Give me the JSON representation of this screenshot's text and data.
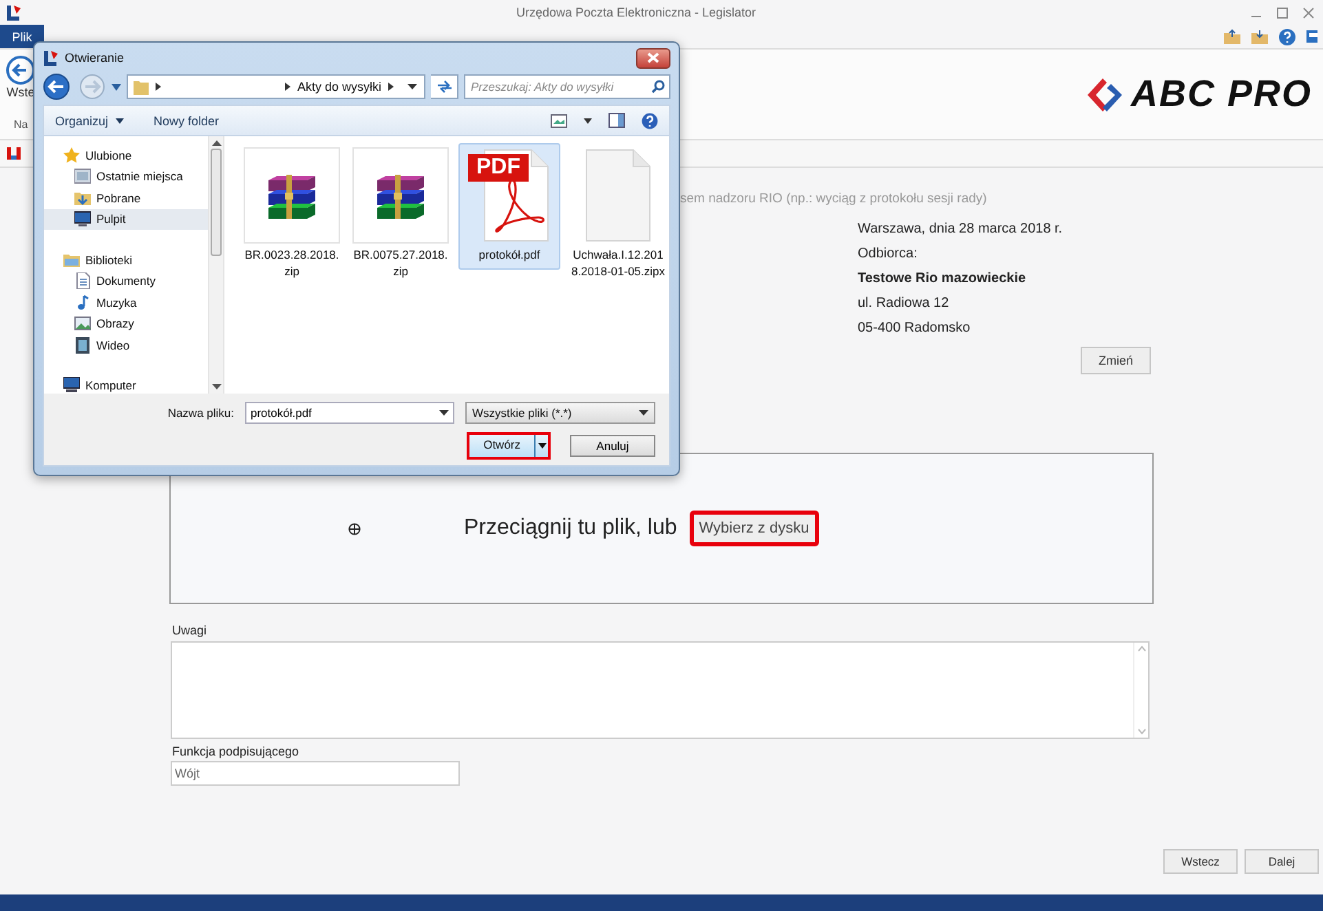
{
  "app": {
    "title": "Urzędowa Poczta Elektroniczna - Legislator",
    "file_tab": "Plik",
    "back_label": "Wste",
    "group_label": "Na",
    "logo": "ABC PRO"
  },
  "form": {
    "hint": "sem nadzoru RIO (np.: wyciąg z protokołu sesji rady)",
    "place_date": "Warszawa, dnia 28 marca 2018 r.",
    "recipient_label": "Odbiorca:",
    "recipient_name": "Testowe Rio mazowieckie",
    "recipient_lines": [
      "ul. Radiowa 12",
      "05-400 Radomsko"
    ],
    "change_button": "Zmień",
    "drop_text": "Przeciągnij tu plik, lub",
    "choose_button": {
      "label": "Wybierz z dysku",
      "highlighted": true
    },
    "notes_label": "Uwagi",
    "signer_label": "Funkcja podpisującego",
    "signer_value": "Wójt"
  },
  "nav_buttons": [
    "Wstecz",
    "Dalej"
  ],
  "dialog": {
    "title": "Otwieranie",
    "path": [
      "Akty do wysyłki"
    ],
    "search_placeholder": "Przeszukaj: Akty do wysyłki",
    "organize": "Organizuj",
    "new_folder": "Nowy folder",
    "nav": [
      {
        "label": "Ulubione",
        "kind": "star",
        "selected": false,
        "children": [
          {
            "label": "Ostatnie miejsca",
            "kind": "recent",
            "selected": false
          },
          {
            "label": "Pobrane",
            "kind": "download",
            "selected": false
          },
          {
            "label": "Pulpit",
            "kind": "desktop",
            "selected": true
          }
        ]
      },
      {
        "label": "Biblioteki",
        "kind": "library",
        "selected": false,
        "children": [
          {
            "label": "Dokumenty",
            "kind": "document",
            "selected": false
          },
          {
            "label": "Muzyka",
            "kind": "music",
            "selected": false
          },
          {
            "label": "Obrazy",
            "kind": "image",
            "selected": false
          },
          {
            "label": "Wideo",
            "kind": "video",
            "selected": false
          }
        ]
      },
      {
        "label": "Komputer",
        "kind": "computer",
        "selected": false
      }
    ],
    "files": [
      {
        "name": "BR.0023.28.2018.zip",
        "kind": "archive",
        "selected": false
      },
      {
        "name": "BR.0075.27.2018.zip",
        "kind": "archive",
        "selected": false
      },
      {
        "name": "protokół.pdf",
        "kind": "pdf",
        "badge": "PDF",
        "selected": true
      },
      {
        "name": "Uchwała.I.12.2018.2018-01-05.zipx",
        "kind": "blank",
        "selected": false
      }
    ],
    "filename_label": "Nazwa pliku:",
    "filename_value": "protokół.pdf",
    "filter": "Wszystkie pliki (*.*)",
    "open_button": {
      "label": "Otwórz",
      "highlighted": true
    },
    "cancel_button": "Anuluj"
  }
}
